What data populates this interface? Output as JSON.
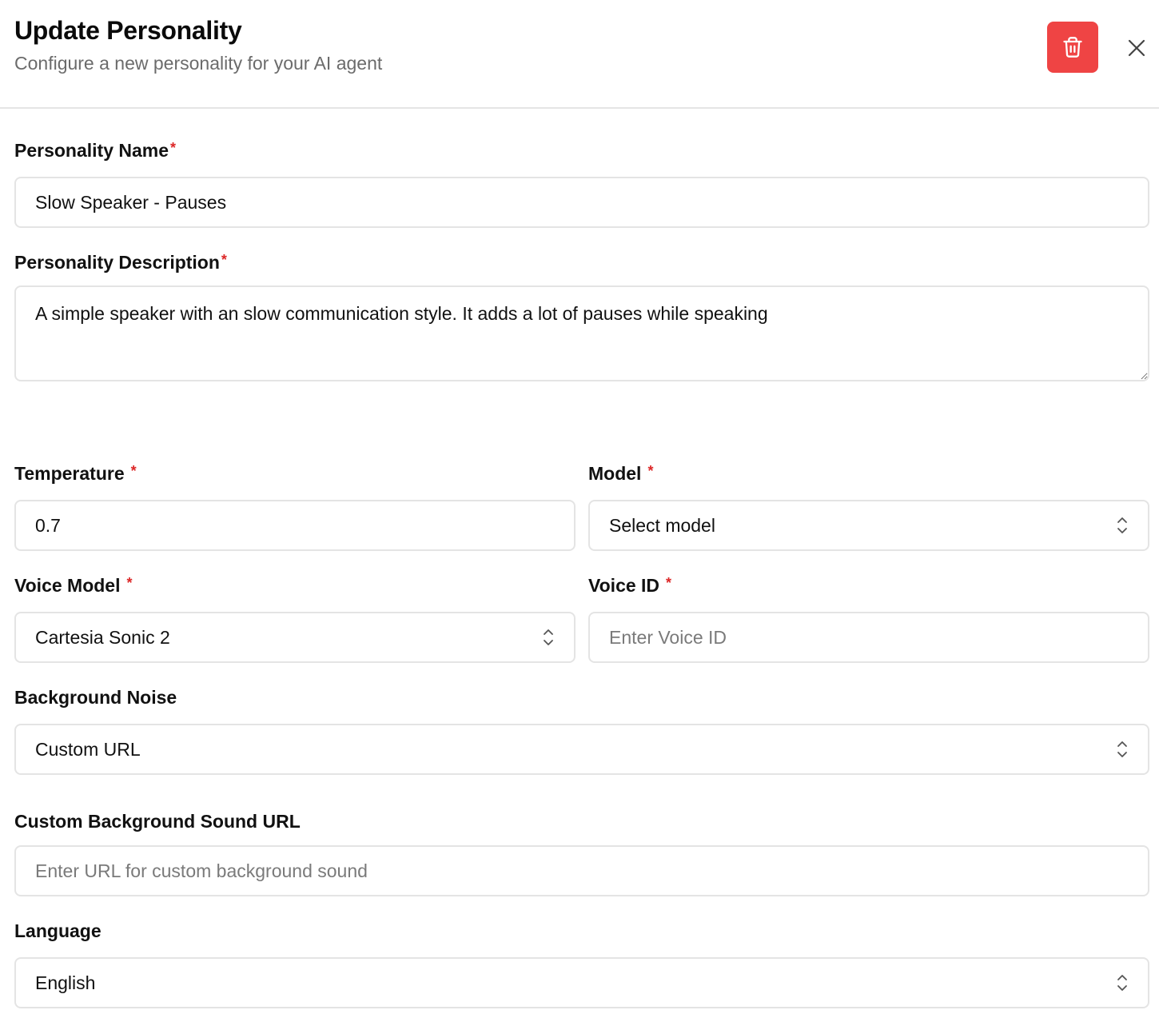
{
  "header": {
    "title": "Update Personality",
    "subtitle": "Configure a new personality for your AI agent",
    "delete_icon": "trash-icon",
    "close_icon": "close-icon",
    "delete_color": "#ef4444"
  },
  "form": {
    "required_mark": "*",
    "name": {
      "label": "Personality Name",
      "value": "Slow Speaker - Pauses"
    },
    "description": {
      "label": "Personality Description",
      "value": "A simple speaker with an slow communication style. It adds a lot of pauses while speaking"
    },
    "temperature": {
      "label": "Temperature",
      "value": "0.7"
    },
    "model": {
      "label": "Model",
      "selected": "Select model"
    },
    "voice_model": {
      "label": "Voice Model",
      "selected": "Cartesia Sonic 2"
    },
    "voice_id": {
      "label": "Voice ID",
      "placeholder": "Enter Voice ID"
    },
    "background_noise": {
      "label": "Background Noise",
      "selected": "Custom URL"
    },
    "custom_sound_url": {
      "label": "Custom Background Sound URL",
      "placeholder": "Enter URL for custom background sound"
    },
    "language": {
      "label": "Language",
      "selected": "English"
    }
  }
}
